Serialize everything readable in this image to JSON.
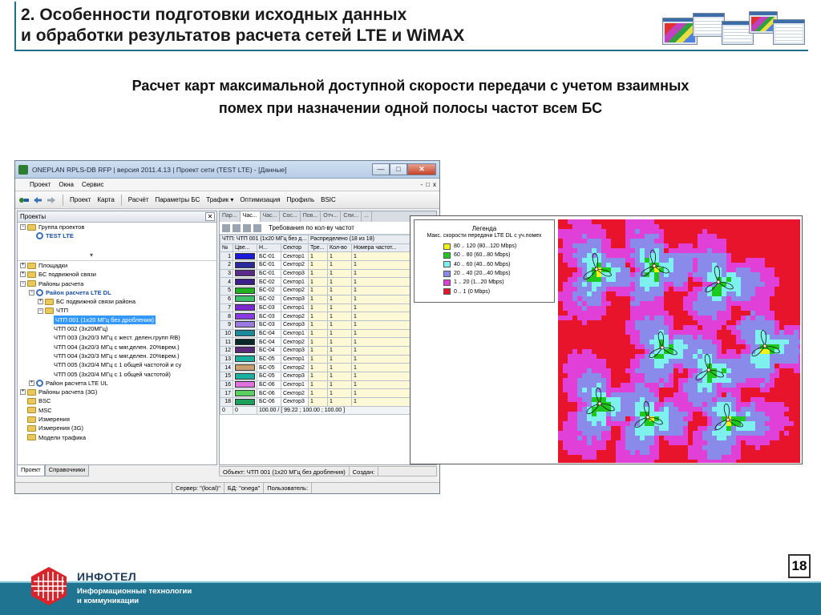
{
  "slide": {
    "title_line1": "2. Особенности подготовки исходных данных",
    "title_line2": "и обработки результатов расчета сетей LTE и WiMAX",
    "subtitle_line1": "Расчет карт максимальной доступной скорости передачи с учетом взаимных",
    "subtitle_line2": "помех при назначении одной полосы частот всем БС",
    "page_number": "18",
    "brand": "ИНФОТЕЛ",
    "brand_sub_line1": "Информационные технологии",
    "brand_sub_line2": "и коммуникации"
  },
  "colors": {
    "accent": "#1f7492",
    "map_red": "#e8142c",
    "map_magenta": "#e040d8",
    "map_purple": "#8a8aea",
    "map_cyan": "#7ef0ee",
    "map_green": "#1ec81e",
    "map_yellow": "#f2f21a"
  },
  "app": {
    "title": "ONEPLAN RPLS-DB RFP | версия 2011.4.13 | Проект сети (TEST LTE) - [Данные]",
    "window_buttons": [
      "—",
      "□",
      "✕"
    ],
    "menu": [
      "Проект",
      "Окна",
      "Сервис"
    ],
    "menu_right": [
      "-",
      "□",
      "x"
    ],
    "toolbar": [
      "Проект",
      "Карта",
      "Расчёт",
      "Параметры БС",
      "Трафик ▾",
      "Оптимизация",
      "Профиль",
      "BSIC"
    ],
    "left_pane_title": "Проекты",
    "tree_top": [
      {
        "label": "Группа проектов",
        "level": 0,
        "icon": "folder",
        "toggle": "−"
      },
      {
        "label": "TEST LTE",
        "level": 1,
        "icon": "net",
        "toggle": "",
        "bold": true
      }
    ],
    "tree": [
      {
        "label": "Площадки",
        "level": 0,
        "toggle": "+",
        "icon": "folder"
      },
      {
        "label": "БС подвижной связи",
        "level": 0,
        "toggle": "+",
        "icon": "folder"
      },
      {
        "label": "Районы расчета",
        "level": 0,
        "toggle": "−",
        "icon": "folder"
      },
      {
        "label": "Район расчета LTE DL",
        "level": 1,
        "toggle": "−",
        "icon": "net",
        "bold": true
      },
      {
        "label": "БС подвижной связи района",
        "level": 2,
        "toggle": "+",
        "icon": "folder"
      },
      {
        "label": "ЧТП",
        "level": 2,
        "toggle": "−",
        "icon": "folder"
      },
      {
        "label": "ЧТП  001 (1x20 МГц без дробления)",
        "level": 3,
        "toggle": "",
        "icon": "",
        "selected": true
      },
      {
        "label": "ЧТП  002 (3x20МГц)",
        "level": 3,
        "toggle": "",
        "icon": ""
      },
      {
        "label": "ЧТП  003 (3x20/3 МГц с жест. делен.групп RB)",
        "level": 3,
        "toggle": "",
        "icon": ""
      },
      {
        "label": "ЧТП  004 (3x20/3 МГц с мяг.делен. 20%врем.)",
        "level": 3,
        "toggle": "",
        "icon": ""
      },
      {
        "label": "ЧТП  004 (3x20/3 МГц с мяг.делен. 20%врем.)",
        "level": 3,
        "toggle": "",
        "icon": ""
      },
      {
        "label": "ЧТП  005 (3x20/4 МГц с 1 общей частотой и су",
        "level": 3,
        "toggle": "",
        "icon": ""
      },
      {
        "label": "ЧТП  005 (3x20/4 МГц с 1 общей частотой)",
        "level": 3,
        "toggle": "",
        "icon": ""
      },
      {
        "label": "Район расчета LTE UL",
        "level": 1,
        "toggle": "+",
        "icon": "net"
      },
      {
        "label": "Районы расчета (3G)",
        "level": 0,
        "toggle": "+",
        "icon": "folder"
      },
      {
        "label": "BSC",
        "level": 0,
        "toggle": "",
        "icon": "folder"
      },
      {
        "label": "MSC",
        "level": 0,
        "toggle": "",
        "icon": "folder"
      },
      {
        "label": "Измерения",
        "level": 0,
        "toggle": "",
        "icon": "folder"
      },
      {
        "label": "Измерения (3G)",
        "level": 0,
        "toggle": "",
        "icon": "folder"
      },
      {
        "label": "Модели трафика",
        "level": 0,
        "toggle": "",
        "icon": "folder"
      }
    ],
    "bottom_tabs": [
      "Проект",
      "Справочники"
    ],
    "right_tabs": [
      "Пар...",
      "Час...",
      "Час...",
      "Сос...",
      "Пов...",
      "Отч...",
      "Спи...",
      "..."
    ],
    "req_title": "Требования по кол-ву частот",
    "grid_head1": [
      "ЧТП: ЧТП  001 (1x20 МГц без д...",
      "Распределено (18 из 18)"
    ],
    "grid_head2": [
      "№",
      "Цве...",
      "Н...",
      "Сектор",
      "Тре...",
      "Кол-во",
      "Номера частот..."
    ],
    "grid_rows": [
      {
        "n": "1",
        "color": "#1a1ad8",
        "bs": "БС-01",
        "sector": "Сектор1",
        "req": "1",
        "qty": "1",
        "freq": "1"
      },
      {
        "n": "2",
        "color": "#2a2a9c",
        "bs": "БС-01",
        "sector": "Сектор2",
        "req": "1",
        "qty": "1",
        "freq": "1"
      },
      {
        "n": "3",
        "color": "#5a2a8a",
        "bs": "БС-01",
        "sector": "Сектор3",
        "req": "1",
        "qty": "1",
        "freq": "1"
      },
      {
        "n": "4",
        "color": "#3c1e8a",
        "bs": "БС-02",
        "sector": "Сектор1",
        "req": "1",
        "qty": "1",
        "freq": "1"
      },
      {
        "n": "5",
        "color": "#22b022",
        "bs": "БС-02",
        "sector": "Сектор2",
        "req": "1",
        "qty": "1",
        "freq": "1"
      },
      {
        "n": "6",
        "color": "#3cc06a",
        "bs": "БС-02",
        "sector": "Сектор3",
        "req": "1",
        "qty": "1",
        "freq": "1"
      },
      {
        "n": "7",
        "color": "#7a2ad0",
        "bs": "БС-03",
        "sector": "Сектор1",
        "req": "1",
        "qty": "1",
        "freq": "1"
      },
      {
        "n": "8",
        "color": "#8a3ae0",
        "bs": "БС-03",
        "sector": "Сектор2",
        "req": "1",
        "qty": "1",
        "freq": "1"
      },
      {
        "n": "9",
        "color": "#9a7ae0",
        "bs": "БС-03",
        "sector": "Сектор3",
        "req": "1",
        "qty": "1",
        "freq": "1"
      },
      {
        "n": "10",
        "color": "#1a8a9a",
        "bs": "БС-04",
        "sector": "Сектор1",
        "req": "1",
        "qty": "1",
        "freq": "1"
      },
      {
        "n": "11",
        "color": "#0a2a2a",
        "bs": "БС-04",
        "sector": "Сектор2",
        "req": "1",
        "qty": "1",
        "freq": "1"
      },
      {
        "n": "12",
        "color": "#5a2a7a",
        "bs": "БС-04",
        "sector": "Сектор3",
        "req": "1",
        "qty": "1",
        "freq": "1"
      },
      {
        "n": "13",
        "color": "#1ab0a0",
        "bs": "БС-05",
        "sector": "Сектор1",
        "req": "1",
        "qty": "1",
        "freq": "1"
      },
      {
        "n": "14",
        "color": "#c8a070",
        "bs": "БС-05",
        "sector": "Сектор2",
        "req": "1",
        "qty": "1",
        "freq": "1"
      },
      {
        "n": "15",
        "color": "#1ab0a0",
        "bs": "БС-05",
        "sector": "Сектор3",
        "req": "1",
        "qty": "1",
        "freq": "1"
      },
      {
        "n": "16",
        "color": "#e070e0",
        "bs": "БС-06",
        "sector": "Сектор1",
        "req": "1",
        "qty": "1",
        "freq": "1"
      },
      {
        "n": "17",
        "color": "#5ad060",
        "bs": "БС-06",
        "sector": "Сектор2",
        "req": "1",
        "qty": "1",
        "freq": "1"
      },
      {
        "n": "18",
        "color": "#1aa05a",
        "bs": "БС-06",
        "sector": "Сектор3",
        "req": "1",
        "qty": "1",
        "freq": "1"
      }
    ],
    "grid_footer": [
      "0",
      "0",
      "100.00 / [ 99.22 ; 100.00 ; 100.00 ]"
    ],
    "object_bar": "Объект: ЧТП  001 (1x20 МГц без дробления)",
    "object_bar_right": "Создан:",
    "status": [
      "",
      "Сервер: \"(local)\"",
      "БД: \"onega\"",
      "Пользователь:"
    ]
  },
  "legend": {
    "title": "Легенда",
    "subtitle": "Макс. скорости передачи LTE DL с уч.помех",
    "items": [
      {
        "label": "80 .. 120   (80...120 Mbps)",
        "color": "#f2f21a"
      },
      {
        "label": "60 .. 80   (60...80 Mbps)",
        "color": "#1ec81e"
      },
      {
        "label": "40 .. 60   (40...60 Mbps)",
        "color": "#7ef0ee"
      },
      {
        "label": "20 .. 40   (20...40 Mbps)",
        "color": "#8a8aea"
      },
      {
        "label": "1 .. 20   (1...20 Mbps)",
        "color": "#e040d8"
      },
      {
        "label": "0 .. 1   (0 Mbps)",
        "color": "#e8142c"
      }
    ]
  }
}
